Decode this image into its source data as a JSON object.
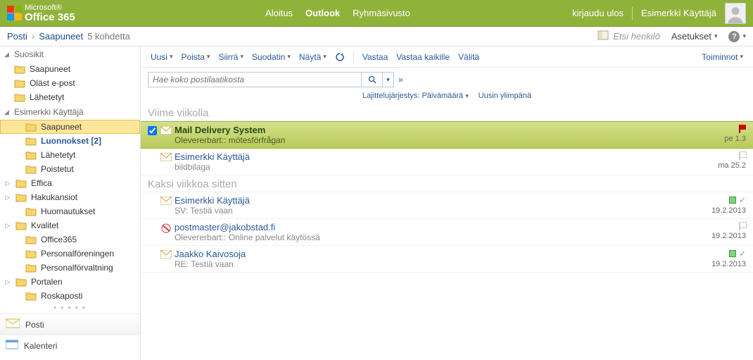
{
  "header": {
    "brand_top": "Microsoft®",
    "brand_main": "Office 365",
    "nav": {
      "start": "Aloitus",
      "outlook": "Outlook",
      "teamsite": "Ryhmäsivusto"
    },
    "signout": "kirjaudu ulos",
    "username": "Esimerkki Käyttäjä"
  },
  "breadcrumb": {
    "root": "Posti",
    "folder": "Saapuneet",
    "count": "5 kohdetta",
    "find_person": "Etsi henkilö",
    "settings": "Asetukset"
  },
  "sidebar": {
    "favorites": "Suosikit",
    "fav_items": [
      {
        "label": "Saapuneet"
      },
      {
        "label": "Oläst e-post"
      },
      {
        "label": "Lähetetyt"
      }
    ],
    "mailbox": "Esimerkki Käyttäjä",
    "mb_items": [
      {
        "label": "Saapuneet",
        "selected": true
      },
      {
        "label": "Luonnokset",
        "bold": true,
        "badge": "[2]"
      },
      {
        "label": "Lähetetyt"
      },
      {
        "label": "Poistetut"
      },
      {
        "label": "Effica",
        "expand": true
      },
      {
        "label": "Hakukansiot",
        "expand": true
      },
      {
        "label": "Huomautukset"
      },
      {
        "label": "Kvalitet",
        "expand": true
      },
      {
        "label": "Office365"
      },
      {
        "label": "Personalföreningen"
      },
      {
        "label": "Personalförvaltning"
      },
      {
        "label": "Portalen",
        "expand": true
      },
      {
        "label": "Roskaposti"
      }
    ],
    "rail": {
      "mail": "Posti",
      "calendar": "Kalenteri"
    }
  },
  "toolbar": {
    "new": "Uusi",
    "delete": "Poista",
    "move": "Siirrä",
    "filter": "Suodatin",
    "view": "Näytä",
    "reply": "Vastaa",
    "replyall": "Vastaa kaikille",
    "forward": "Välitä",
    "actions": "Toiminnot"
  },
  "search": {
    "placeholder": "Hae koko postilaatikosta",
    "sort_label": "Lajittelujärjestys:",
    "sort_field": "Päivämäärä",
    "sort_order": "Uusin ylimpänä"
  },
  "groups": [
    {
      "title": "Viime viikolla",
      "messages": [
        {
          "from": "Mail Delivery System",
          "subject": "Olevererbart:: mötesförfrågan",
          "date": "pe 1.3",
          "selected": true,
          "flag": "red"
        },
        {
          "from": "Esimerkki Käyttäjä",
          "subject": "bildbilaga",
          "date": "ma 25.2"
        }
      ]
    },
    {
      "title": "Kaksi viikkoa sitten",
      "messages": [
        {
          "from": "Esimerkki Käyttäjä",
          "subject": "SV: Testiä vaan",
          "date": "19.2.2013",
          "cat": "green",
          "check": true
        },
        {
          "from": "postmaster@jakobstad.fi",
          "subject": "Olevererbart:: Online palvelut käytössä",
          "date": "19.2.2013",
          "special": true
        },
        {
          "from": "Jaakko Kaivosoja",
          "subject": "RE: Testiä vaan",
          "date": "19.2.2013",
          "cat": "green",
          "check": true
        }
      ]
    }
  ]
}
